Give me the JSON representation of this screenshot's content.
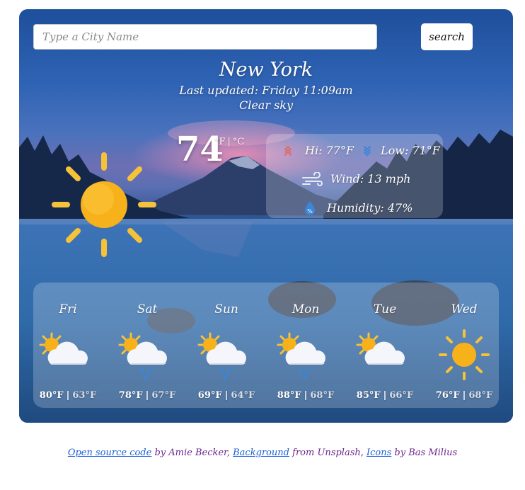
{
  "search": {
    "placeholder": "Type a City Name",
    "value": "",
    "button_label": "search"
  },
  "current": {
    "city": "New York",
    "last_updated": "Last updated: Friday 11:09am",
    "description": "Clear sky",
    "temperature": "74",
    "unit_f": "°F",
    "unit_separator": "|",
    "unit_c": "°C",
    "icon": "sun-icon"
  },
  "stats": {
    "hi": "Hi: 77°F",
    "low": "Low: 71°F",
    "wind": "Wind: 13 mph",
    "humidity": "Humidity: 47%"
  },
  "forecast": [
    {
      "day": "Fri",
      "hi": "80°F",
      "lo": "63°F",
      "icon": "partly-cloudy-icon"
    },
    {
      "day": "Sat",
      "hi": "78°F",
      "lo": "67°F",
      "icon": "partly-cloudy-rain-icon"
    },
    {
      "day": "Sun",
      "hi": "69°F",
      "lo": "64°F",
      "icon": "partly-cloudy-rain-icon"
    },
    {
      "day": "Mon",
      "hi": "88°F",
      "lo": "68°F",
      "icon": "partly-cloudy-rain-icon"
    },
    {
      "day": "Tue",
      "hi": "85°F",
      "lo": "66°F",
      "icon": "partly-cloudy-icon"
    },
    {
      "day": "Wed",
      "hi": "76°F",
      "lo": "68°F",
      "icon": "sun-icon"
    }
  ],
  "footer": {
    "source_link": "Open source code",
    "by_author": " by Amie Becker, ",
    "background_link": "Background",
    "from_unsplash": " from Unsplash, ",
    "icons_link": "Icons",
    "by_icon_author": " by Bas Milius"
  },
  "colors": {
    "footer_text": "#6a2690",
    "link": "#1b5fd8",
    "sun": "#f7b21b",
    "sun_rays": "#f5c23a"
  }
}
